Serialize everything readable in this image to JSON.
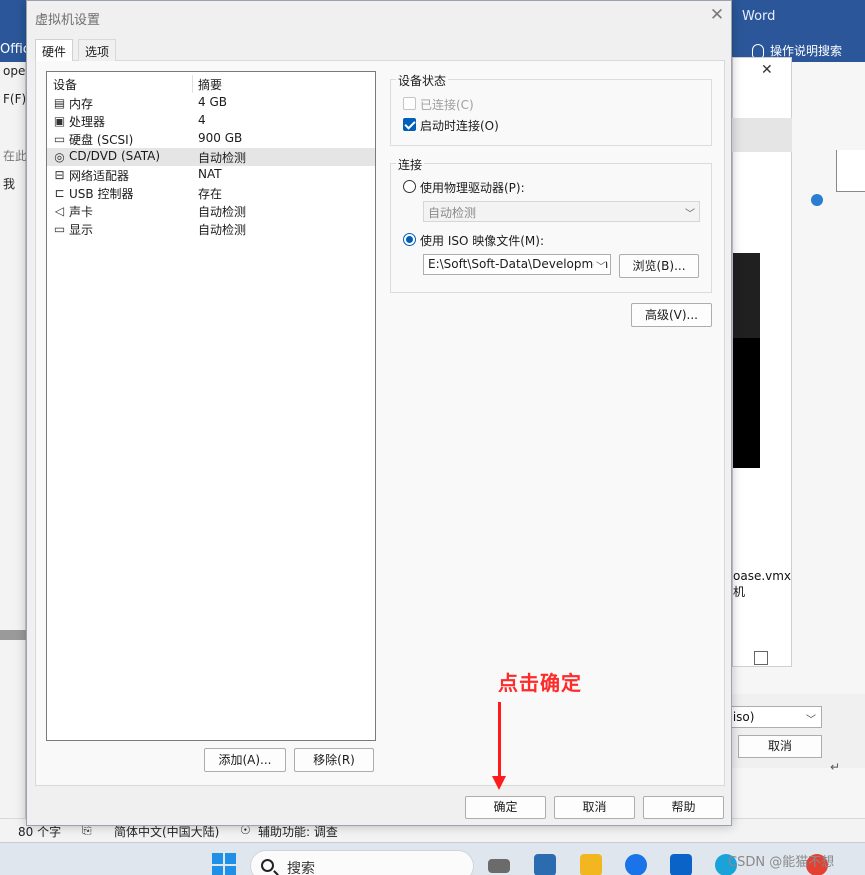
{
  "background_app": {
    "title": "Word",
    "office_label": "Offic",
    "help_label": "操作说明搜索",
    "left_fragments": [
      "ope",
      "F(F)",
      "在此",
      "我"
    ],
    "vmx_line1": "oase.vmx",
    "vmx_line2": "机",
    "combo_value": ".iso)",
    "cancel_label": "取消"
  },
  "statusbar": {
    "words": "80 个字",
    "language": "简体中文(中国大陆)",
    "accessibility": "辅助功能: 调查"
  },
  "taskbar": {
    "search_placeholder": "搜索",
    "watermark": "CSDN @能猫不想"
  },
  "dialog": {
    "title": "虚拟机设置",
    "close_glyph": "✕",
    "tabs": [
      {
        "label": "硬件",
        "active": true
      },
      {
        "label": "选项",
        "active": false
      }
    ],
    "device_list": {
      "col_device": "设备",
      "col_summary": "摘要",
      "rows": [
        {
          "icon": "memory-icon",
          "name": "内存",
          "summary": "4 GB",
          "selected": false
        },
        {
          "icon": "processor-icon",
          "name": "处理器",
          "summary": "4",
          "selected": false
        },
        {
          "icon": "hard-disk-icon",
          "name": "硬盘 (SCSI)",
          "summary": "900 GB",
          "selected": false
        },
        {
          "icon": "cd-dvd-icon",
          "name": "CD/DVD (SATA)",
          "summary": "自动检测",
          "selected": true
        },
        {
          "icon": "network-adapter-icon",
          "name": "网络适配器",
          "summary": "NAT",
          "selected": false
        },
        {
          "icon": "usb-controller-icon",
          "name": "USB 控制器",
          "summary": "存在",
          "selected": false
        },
        {
          "icon": "sound-card-icon",
          "name": "声卡",
          "summary": "自动检测",
          "selected": false
        },
        {
          "icon": "display-icon",
          "name": "显示",
          "summary": "自动检测",
          "selected": false
        }
      ]
    },
    "add_label": "添加(A)...",
    "remove_label": "移除(R)",
    "device_status": {
      "title": "设备状态",
      "connected_label": "已连接(C)",
      "connected_checked": false,
      "connected_disabled": true,
      "connect_on_start_label": "启动时连接(O)",
      "connect_on_start_checked": true
    },
    "connection": {
      "title": "连接",
      "physical_label": "使用物理驱动器(P):",
      "physical_selected": false,
      "physical_value": "自动检测",
      "iso_label": "使用 ISO 映像文件(M):",
      "iso_selected": true,
      "iso_value": "E:\\Soft\\Soft-Data\\Developmen",
      "browse_label": "浏览(B)..."
    },
    "advanced_label": "高级(V)...",
    "ok_label": "确定",
    "cancel_label": "取消",
    "help_label": "帮助"
  },
  "annotation": {
    "text": "点击确定",
    "color": "#ff2a2a"
  },
  "colors": {
    "word_blue": "#2b579a",
    "accent": "#005fb8"
  }
}
